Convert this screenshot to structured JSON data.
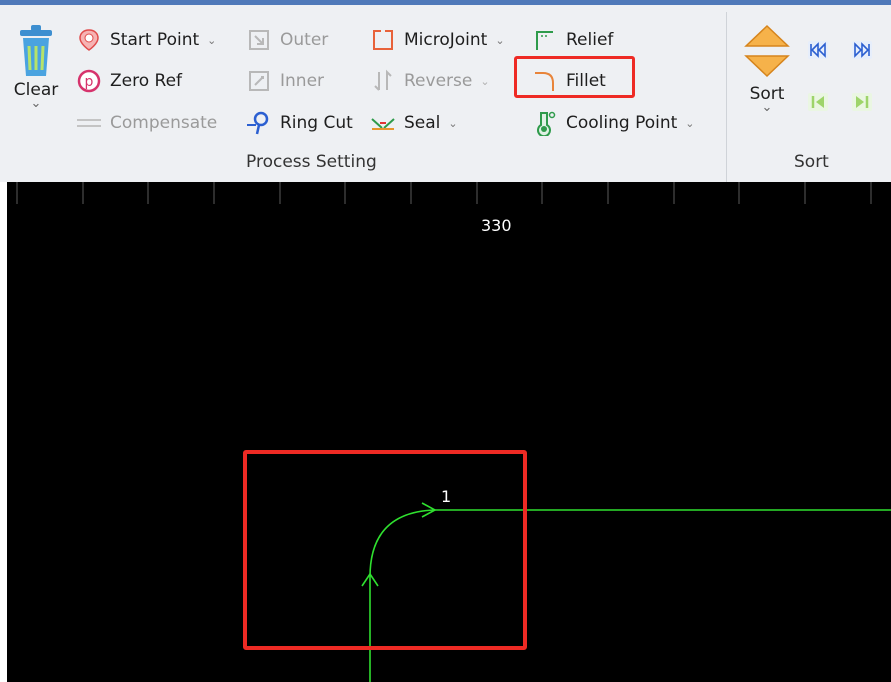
{
  "ribbon": {
    "clear": {
      "label": "Clear",
      "caret": "⌄"
    },
    "process_setting": {
      "group_label": "Process Setting",
      "start_point": "Start Point",
      "zero_ref": "Zero Ref",
      "compensate": "Compensate",
      "outer": "Outer",
      "inner": "Inner",
      "ring_cut": "Ring Cut",
      "microjoint": "MicroJoint",
      "reverse": "Reverse",
      "seal": "Seal",
      "relief": "Relief",
      "fillet": "Fillet",
      "cooling_point": "Cooling Point"
    },
    "sort": {
      "label": "Sort",
      "group_label": "Sort",
      "caret": "⌄"
    },
    "dropdown_caret": "⌄"
  },
  "canvas": {
    "ruler_label": "330",
    "path_label": "1"
  },
  "colors": {
    "highlight": "#ee2a24",
    "path": "#2fe02f",
    "canvas_bg": "#000000",
    "ribbon_bg": "#eef0f3"
  }
}
